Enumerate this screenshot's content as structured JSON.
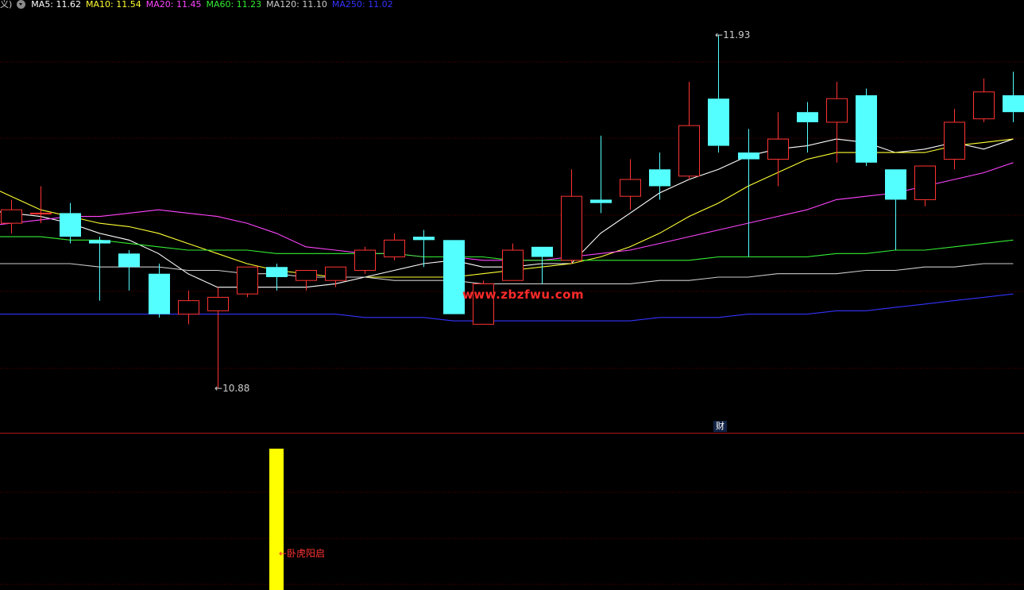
{
  "legend": {
    "lead": "义)",
    "ma_items": [
      {
        "label": "MA5: 11.62",
        "color": "#ffffff"
      },
      {
        "label": "MA10: 11.54",
        "color": "#ffff33"
      },
      {
        "label": "MA20: 11.45",
        "color": "#ff44ff"
      },
      {
        "label": "MA60: 11.23",
        "color": "#33ee33"
      },
      {
        "label": "MA120: 11.10",
        "color": "#cccccc"
      },
      {
        "label": "MA250: 11.02",
        "color": "#3333ff"
      }
    ]
  },
  "watermark": "www.zbzfwu.com",
  "annotations": {
    "high_label": "11.93",
    "low_label": "10.88",
    "finance_badge": "财",
    "signal_label": "←卧虎阳启"
  },
  "colors": {
    "background": "#000000",
    "up": "#ff3333",
    "down": "#54ffff",
    "grid": "#5a0000",
    "separator": "#aa1818",
    "indicator_bar": "#ffff00"
  },
  "chart_data": {
    "type": "candlestick",
    "y_axis": {
      "min": 10.75,
      "max": 12.0
    },
    "grid": true,
    "candles": [
      {
        "o": 11.37,
        "c": 11.41,
        "h": 11.44,
        "l": 11.34
      },
      {
        "o": 11.4,
        "c": 11.4,
        "h": 11.48,
        "l": 11.37
      },
      {
        "o": 11.4,
        "c": 11.33,
        "h": 11.43,
        "l": 11.31
      },
      {
        "o": 11.32,
        "c": 11.31,
        "h": 11.33,
        "l": 11.14
      },
      {
        "o": 11.28,
        "c": 11.24,
        "h": 11.29,
        "l": 11.17
      },
      {
        "o": 11.22,
        "c": 11.1,
        "h": 11.25,
        "l": 11.09
      },
      {
        "o": 11.1,
        "c": 11.14,
        "h": 11.17,
        "l": 11.07
      },
      {
        "o": 11.11,
        "c": 11.15,
        "h": 11.18,
        "l": 10.88
      },
      {
        "o": 11.16,
        "c": 11.24,
        "h": 11.24,
        "l": 11.15
      },
      {
        "o": 11.24,
        "c": 11.21,
        "h": 11.25,
        "l": 11.17
      },
      {
        "o": 11.2,
        "c": 11.23,
        "h": 11.23,
        "l": 11.17
      },
      {
        "o": 11.2,
        "c": 11.24,
        "h": 11.24,
        "l": 11.18
      },
      {
        "o": 11.23,
        "c": 11.29,
        "h": 11.3,
        "l": 11.22
      },
      {
        "o": 11.27,
        "c": 11.32,
        "h": 11.34,
        "l": 11.26
      },
      {
        "o": 11.33,
        "c": 11.32,
        "h": 11.35,
        "l": 11.24
      },
      {
        "o": 11.32,
        "c": 11.1,
        "h": 11.32,
        "l": 11.1
      },
      {
        "o": 11.07,
        "c": 11.19,
        "h": 11.2,
        "l": 11.07
      },
      {
        "o": 11.2,
        "c": 11.29,
        "h": 11.31,
        "l": 11.2
      },
      {
        "o": 11.3,
        "c": 11.27,
        "h": 11.3,
        "l": 11.19
      },
      {
        "o": 11.26,
        "c": 11.45,
        "h": 11.53,
        "l": 11.25
      },
      {
        "o": 11.44,
        "c": 11.43,
        "h": 11.63,
        "l": 11.4
      },
      {
        "o": 11.45,
        "c": 11.5,
        "h": 11.56,
        "l": 11.41
      },
      {
        "o": 11.53,
        "c": 11.48,
        "h": 11.58,
        "l": 11.44
      },
      {
        "o": 11.51,
        "c": 11.66,
        "h": 11.79,
        "l": 11.5
      },
      {
        "o": 11.74,
        "c": 11.6,
        "h": 11.93,
        "l": 11.58
      },
      {
        "o": 11.58,
        "c": 11.56,
        "h": 11.65,
        "l": 11.27
      },
      {
        "o": 11.56,
        "c": 11.62,
        "h": 11.7,
        "l": 11.48
      },
      {
        "o": 11.7,
        "c": 11.67,
        "h": 11.73,
        "l": 11.58
      },
      {
        "o": 11.67,
        "c": 11.74,
        "h": 11.79,
        "l": 11.55
      },
      {
        "o": 11.75,
        "c": 11.55,
        "h": 11.77,
        "l": 11.54
      },
      {
        "o": 11.53,
        "c": 11.44,
        "h": 11.53,
        "l": 11.29
      },
      {
        "o": 11.44,
        "c": 11.54,
        "h": 11.54,
        "l": 11.42
      },
      {
        "o": 11.56,
        "c": 11.67,
        "h": 11.71,
        "l": 11.53
      },
      {
        "o": 11.68,
        "c": 11.76,
        "h": 11.8,
        "l": 11.67
      },
      {
        "o": 11.75,
        "c": 11.7,
        "h": 11.82,
        "l": 11.67
      }
    ],
    "ma_series": [
      {
        "name": "MA5",
        "color": "#ffffff",
        "values": [
          11.4,
          11.39,
          11.37,
          11.34,
          11.32,
          11.28,
          11.22,
          11.18,
          11.18,
          11.18,
          11.18,
          11.19,
          11.21,
          11.23,
          11.25,
          11.26,
          11.24,
          11.24,
          11.25,
          11.25,
          11.34,
          11.4,
          11.46,
          11.5,
          11.53,
          11.57,
          11.59,
          11.6,
          11.62,
          11.61,
          11.58,
          11.59,
          11.61,
          11.59,
          11.62
        ]
      },
      {
        "name": "MA10",
        "color": "#ffff33",
        "values": [
          11.45,
          11.41,
          11.39,
          11.37,
          11.36,
          11.34,
          11.31,
          11.28,
          11.25,
          11.23,
          11.22,
          11.21,
          11.21,
          11.21,
          11.21,
          11.21,
          11.22,
          11.23,
          11.24,
          11.25,
          11.27,
          11.3,
          11.34,
          11.39,
          11.43,
          11.48,
          11.52,
          11.56,
          11.58,
          11.58,
          11.58,
          11.58,
          11.6,
          11.61,
          11.62
        ]
      },
      {
        "name": "MA20",
        "color": "#ff44ff",
        "values": [
          11.37,
          11.38,
          11.39,
          11.39,
          11.4,
          11.41,
          11.4,
          11.39,
          11.37,
          11.34,
          11.3,
          11.29,
          11.28,
          11.28,
          11.27,
          11.27,
          11.26,
          11.26,
          11.26,
          11.27,
          11.28,
          11.29,
          11.31,
          11.33,
          11.35,
          11.37,
          11.39,
          11.41,
          11.44,
          11.45,
          11.46,
          11.48,
          11.5,
          11.52,
          11.55
        ]
      },
      {
        "name": "MA60",
        "color": "#33ee33",
        "values": [
          11.33,
          11.33,
          11.32,
          11.32,
          11.31,
          11.3,
          11.29,
          11.29,
          11.29,
          11.28,
          11.28,
          11.28,
          11.28,
          11.28,
          11.27,
          11.27,
          11.27,
          11.26,
          11.26,
          11.26,
          11.26,
          11.26,
          11.26,
          11.26,
          11.27,
          11.27,
          11.27,
          11.27,
          11.28,
          11.28,
          11.29,
          11.29,
          11.3,
          11.31,
          11.32
        ]
      },
      {
        "name": "MA120",
        "color": "#cccccc",
        "values": [
          11.25,
          11.25,
          11.25,
          11.24,
          11.24,
          11.24,
          11.23,
          11.23,
          11.22,
          11.22,
          11.21,
          11.21,
          11.21,
          11.2,
          11.2,
          11.2,
          11.19,
          11.19,
          11.19,
          11.19,
          11.19,
          11.19,
          11.2,
          11.2,
          11.21,
          11.21,
          11.22,
          11.22,
          11.22,
          11.23,
          11.23,
          11.24,
          11.24,
          11.25,
          11.25
        ]
      },
      {
        "name": "MA250",
        "color": "#3333ff",
        "values": [
          11.1,
          11.1,
          11.1,
          11.1,
          11.1,
          11.1,
          11.1,
          11.1,
          11.1,
          11.1,
          11.1,
          11.1,
          11.09,
          11.09,
          11.09,
          11.08,
          11.08,
          11.08,
          11.08,
          11.08,
          11.08,
          11.08,
          11.09,
          11.09,
          11.09,
          11.1,
          11.1,
          11.1,
          11.11,
          11.11,
          11.12,
          11.13,
          11.14,
          11.15,
          11.16
        ]
      }
    ],
    "indicator": {
      "signal_candle_index": 9
    }
  }
}
